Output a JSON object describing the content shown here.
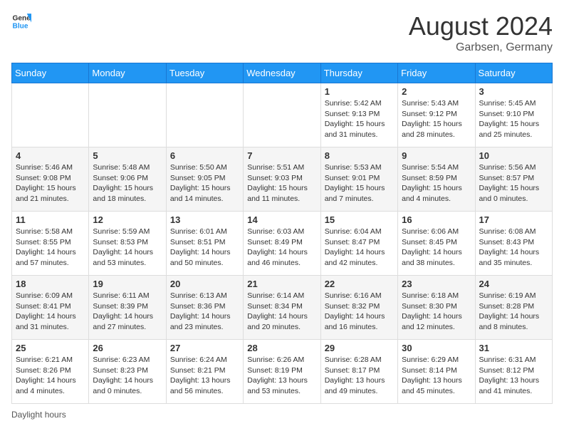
{
  "header": {
    "logo_general": "General",
    "logo_blue": "Blue",
    "month_year": "August 2024",
    "location": "Garbsen, Germany"
  },
  "days_of_week": [
    "Sunday",
    "Monday",
    "Tuesday",
    "Wednesday",
    "Thursday",
    "Friday",
    "Saturday"
  ],
  "weeks": [
    [
      {
        "day": "",
        "sunrise": "",
        "sunset": "",
        "daylight": ""
      },
      {
        "day": "",
        "sunrise": "",
        "sunset": "",
        "daylight": ""
      },
      {
        "day": "",
        "sunrise": "",
        "sunset": "",
        "daylight": ""
      },
      {
        "day": "",
        "sunrise": "",
        "sunset": "",
        "daylight": ""
      },
      {
        "day": "1",
        "sunrise": "Sunrise: 5:42 AM",
        "sunset": "Sunset: 9:13 PM",
        "daylight": "Daylight: 15 hours and 31 minutes."
      },
      {
        "day": "2",
        "sunrise": "Sunrise: 5:43 AM",
        "sunset": "Sunset: 9:12 PM",
        "daylight": "Daylight: 15 hours and 28 minutes."
      },
      {
        "day": "3",
        "sunrise": "Sunrise: 5:45 AM",
        "sunset": "Sunset: 9:10 PM",
        "daylight": "Daylight: 15 hours and 25 minutes."
      }
    ],
    [
      {
        "day": "4",
        "sunrise": "Sunrise: 5:46 AM",
        "sunset": "Sunset: 9:08 PM",
        "daylight": "Daylight: 15 hours and 21 minutes."
      },
      {
        "day": "5",
        "sunrise": "Sunrise: 5:48 AM",
        "sunset": "Sunset: 9:06 PM",
        "daylight": "Daylight: 15 hours and 18 minutes."
      },
      {
        "day": "6",
        "sunrise": "Sunrise: 5:50 AM",
        "sunset": "Sunset: 9:05 PM",
        "daylight": "Daylight: 15 hours and 14 minutes."
      },
      {
        "day": "7",
        "sunrise": "Sunrise: 5:51 AM",
        "sunset": "Sunset: 9:03 PM",
        "daylight": "Daylight: 15 hours and 11 minutes."
      },
      {
        "day": "8",
        "sunrise": "Sunrise: 5:53 AM",
        "sunset": "Sunset: 9:01 PM",
        "daylight": "Daylight: 15 hours and 7 minutes."
      },
      {
        "day": "9",
        "sunrise": "Sunrise: 5:54 AM",
        "sunset": "Sunset: 8:59 PM",
        "daylight": "Daylight: 15 hours and 4 minutes."
      },
      {
        "day": "10",
        "sunrise": "Sunrise: 5:56 AM",
        "sunset": "Sunset: 8:57 PM",
        "daylight": "Daylight: 15 hours and 0 minutes."
      }
    ],
    [
      {
        "day": "11",
        "sunrise": "Sunrise: 5:58 AM",
        "sunset": "Sunset: 8:55 PM",
        "daylight": "Daylight: 14 hours and 57 minutes."
      },
      {
        "day": "12",
        "sunrise": "Sunrise: 5:59 AM",
        "sunset": "Sunset: 8:53 PM",
        "daylight": "Daylight: 14 hours and 53 minutes."
      },
      {
        "day": "13",
        "sunrise": "Sunrise: 6:01 AM",
        "sunset": "Sunset: 8:51 PM",
        "daylight": "Daylight: 14 hours and 50 minutes."
      },
      {
        "day": "14",
        "sunrise": "Sunrise: 6:03 AM",
        "sunset": "Sunset: 8:49 PM",
        "daylight": "Daylight: 14 hours and 46 minutes."
      },
      {
        "day": "15",
        "sunrise": "Sunrise: 6:04 AM",
        "sunset": "Sunset: 8:47 PM",
        "daylight": "Daylight: 14 hours and 42 minutes."
      },
      {
        "day": "16",
        "sunrise": "Sunrise: 6:06 AM",
        "sunset": "Sunset: 8:45 PM",
        "daylight": "Daylight: 14 hours and 38 minutes."
      },
      {
        "day": "17",
        "sunrise": "Sunrise: 6:08 AM",
        "sunset": "Sunset: 8:43 PM",
        "daylight": "Daylight: 14 hours and 35 minutes."
      }
    ],
    [
      {
        "day": "18",
        "sunrise": "Sunrise: 6:09 AM",
        "sunset": "Sunset: 8:41 PM",
        "daylight": "Daylight: 14 hours and 31 minutes."
      },
      {
        "day": "19",
        "sunrise": "Sunrise: 6:11 AM",
        "sunset": "Sunset: 8:39 PM",
        "daylight": "Daylight: 14 hours and 27 minutes."
      },
      {
        "day": "20",
        "sunrise": "Sunrise: 6:13 AM",
        "sunset": "Sunset: 8:36 PM",
        "daylight": "Daylight: 14 hours and 23 minutes."
      },
      {
        "day": "21",
        "sunrise": "Sunrise: 6:14 AM",
        "sunset": "Sunset: 8:34 PM",
        "daylight": "Daylight: 14 hours and 20 minutes."
      },
      {
        "day": "22",
        "sunrise": "Sunrise: 6:16 AM",
        "sunset": "Sunset: 8:32 PM",
        "daylight": "Daylight: 14 hours and 16 minutes."
      },
      {
        "day": "23",
        "sunrise": "Sunrise: 6:18 AM",
        "sunset": "Sunset: 8:30 PM",
        "daylight": "Daylight: 14 hours and 12 minutes."
      },
      {
        "day": "24",
        "sunrise": "Sunrise: 6:19 AM",
        "sunset": "Sunset: 8:28 PM",
        "daylight": "Daylight: 14 hours and 8 minutes."
      }
    ],
    [
      {
        "day": "25",
        "sunrise": "Sunrise: 6:21 AM",
        "sunset": "Sunset: 8:26 PM",
        "daylight": "Daylight: 14 hours and 4 minutes."
      },
      {
        "day": "26",
        "sunrise": "Sunrise: 6:23 AM",
        "sunset": "Sunset: 8:23 PM",
        "daylight": "Daylight: 14 hours and 0 minutes."
      },
      {
        "day": "27",
        "sunrise": "Sunrise: 6:24 AM",
        "sunset": "Sunset: 8:21 PM",
        "daylight": "Daylight: 13 hours and 56 minutes."
      },
      {
        "day": "28",
        "sunrise": "Sunrise: 6:26 AM",
        "sunset": "Sunset: 8:19 PM",
        "daylight": "Daylight: 13 hours and 53 minutes."
      },
      {
        "day": "29",
        "sunrise": "Sunrise: 6:28 AM",
        "sunset": "Sunset: 8:17 PM",
        "daylight": "Daylight: 13 hours and 49 minutes."
      },
      {
        "day": "30",
        "sunrise": "Sunrise: 6:29 AM",
        "sunset": "Sunset: 8:14 PM",
        "daylight": "Daylight: 13 hours and 45 minutes."
      },
      {
        "day": "31",
        "sunrise": "Sunrise: 6:31 AM",
        "sunset": "Sunset: 8:12 PM",
        "daylight": "Daylight: 13 hours and 41 minutes."
      }
    ]
  ],
  "footer": {
    "daylight_hours_label": "Daylight hours"
  }
}
